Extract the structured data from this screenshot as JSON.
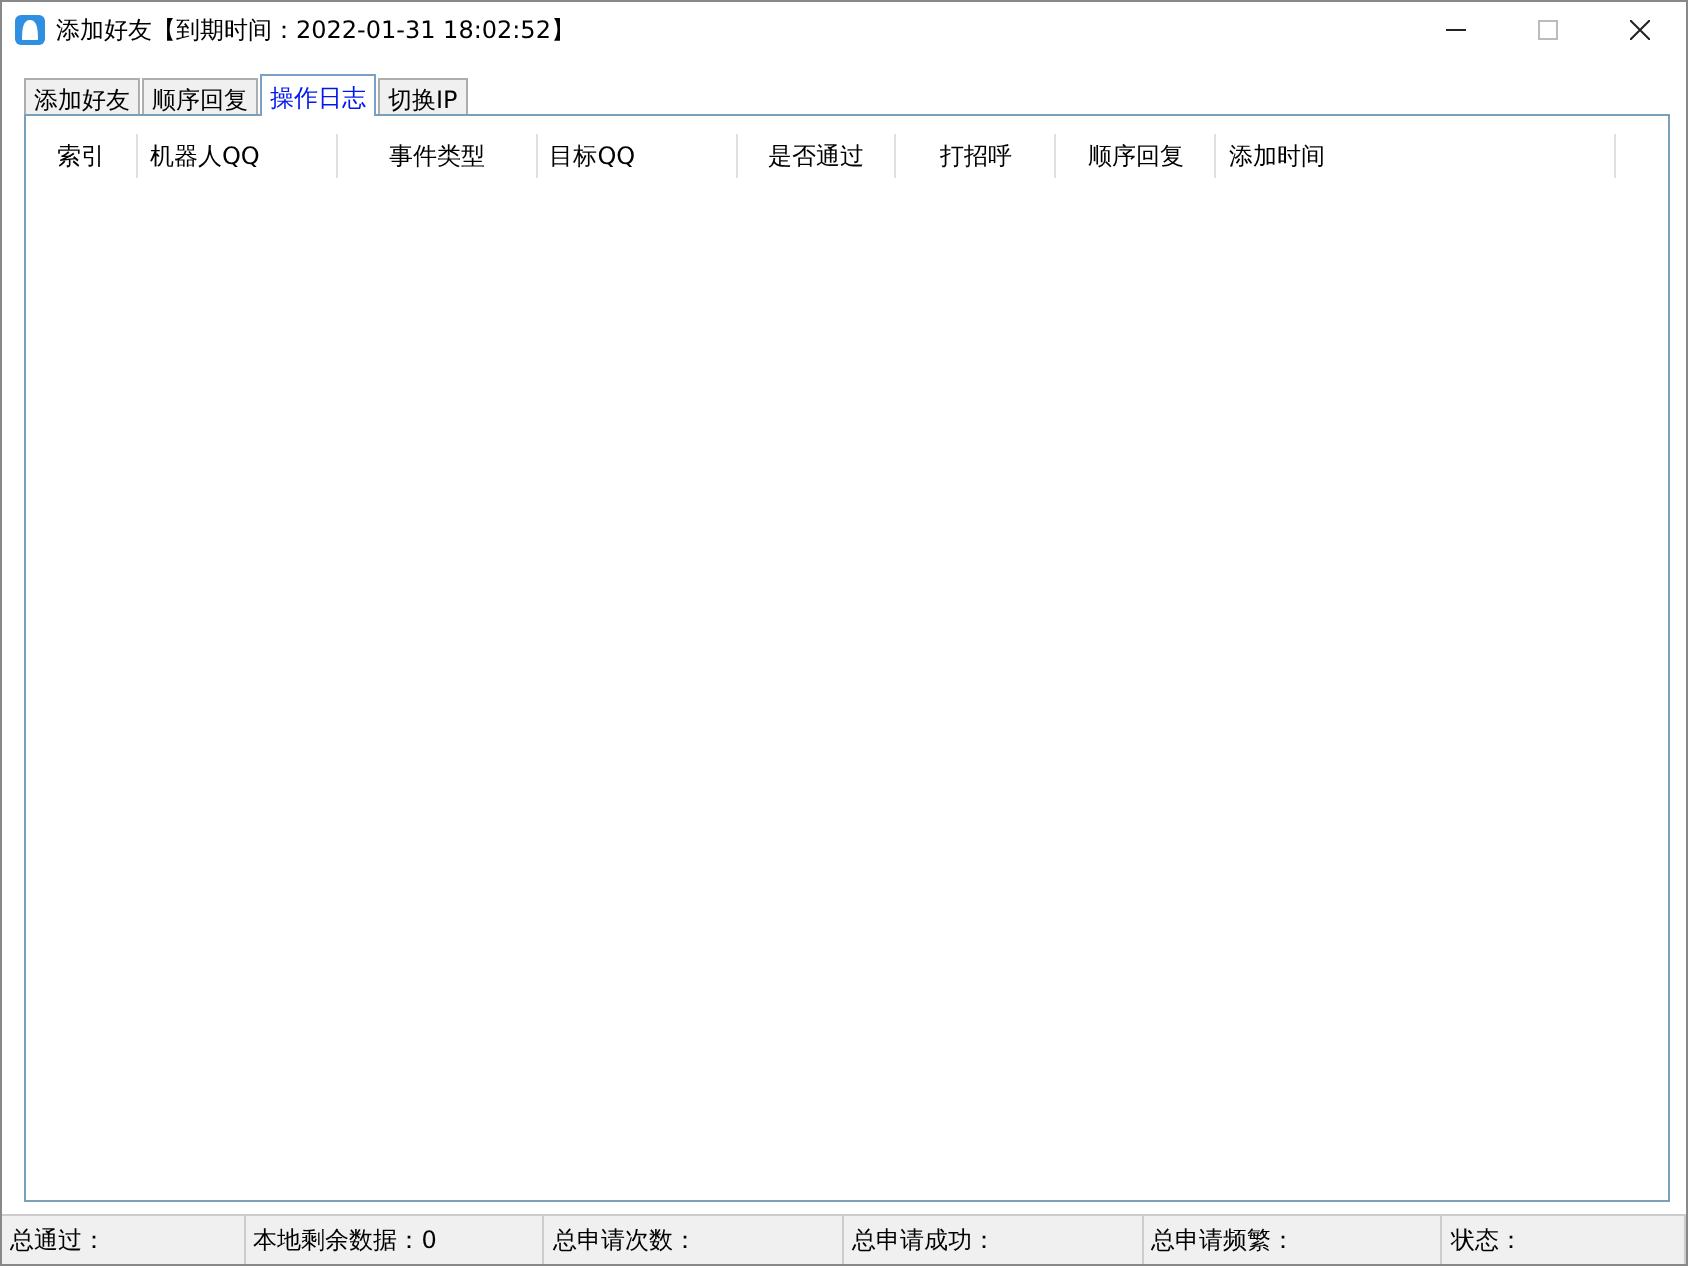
{
  "window": {
    "title": "添加好友【到期时间：2022-01-31 18:02:52】"
  },
  "tabs": [
    {
      "label": "添加好友",
      "selected": false
    },
    {
      "label": "顺序回复",
      "selected": false
    },
    {
      "label": "操作日志",
      "selected": true
    },
    {
      "label": "切换IP",
      "selected": false
    }
  ],
  "table": {
    "columns": [
      "索引",
      "机器人QQ",
      "事件类型",
      "目标QQ",
      "是否通过",
      "打招呼",
      "顺序回复",
      "添加时间"
    ]
  },
  "status_bar": [
    "总通过：",
    "本地剩余数据：0",
    "总申请次数：",
    "总申请成功：",
    "总申请频繁：",
    "状态："
  ]
}
